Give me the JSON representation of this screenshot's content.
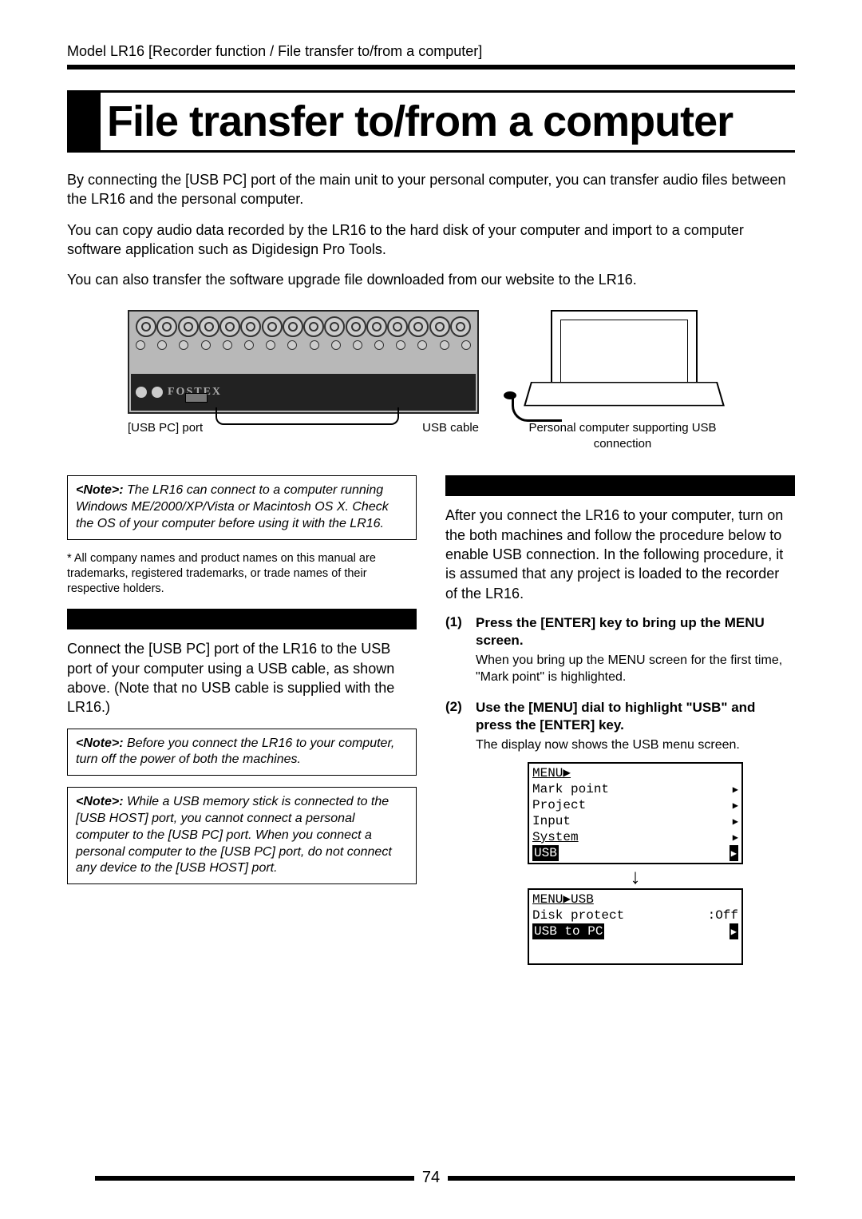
{
  "header": "Model LR16 [Recorder function / File transfer to/from a computer]",
  "title": "File transfer to/from a computer",
  "intro": {
    "p1": "By connecting the [USB PC] port of the main unit to your personal computer, you can transfer audio files between the LR16 and the personal computer.",
    "p2": "You can copy audio data recorded by the LR16 to the hard disk of your computer and import to a computer software application such as Digidesign Pro Tools.",
    "p3": "You can also transfer the software upgrade file downloaded from our website to the LR16."
  },
  "diagram": {
    "usb_port_label": "[USB PC] port",
    "usb_cable_label": "USB cable",
    "laptop_label": "Personal computer supporting USB connection",
    "brand": "FOSTEX"
  },
  "left": {
    "note1_label": "<Note>:",
    "note1": " The LR16 can connect to a computer running Windows ME/2000/XP/Vista or Macintosh OS X. Check the OS of your computer before using it with the LR16.",
    "footnote": "* All company names and product names on this manual are trademarks, registered trademarks, or trade names of their respective holders.",
    "body": "Connect the [USB PC] port of the LR16 to the USB port of your computer using a USB cable, as shown above. (Note that no USB cable is supplied with the LR16.)",
    "note2_label": "<Note>:",
    "note2": " Before you connect the LR16 to your computer, turn off the power of both the machines.",
    "note3_label": "<Note>:",
    "note3": " While a USB memory stick is connected to the [USB HOST] port, you cannot connect a personal computer to the [USB PC] port. When you connect a personal computer to the [USB PC] port, do not connect any device to the [USB HOST] port."
  },
  "right": {
    "body": "After you connect the LR16 to your computer, turn on the both machines and follow the procedure below to enable USB connection. In the following procedure, it is assumed that any project is loaded to the recorder of the LR16.",
    "step1_num": "(1)",
    "step1_title": "Press the [ENTER] key to bring up the MENU screen.",
    "step1_text": "When you bring up the MENU screen for the first time, \"Mark point\" is highlighted.",
    "step2_num": "(2)",
    "step2_title": "Use the [MENU] dial to highlight \"USB\" and press the [ENTER] key.",
    "step2_text": "The display now shows the USB menu screen.",
    "lcd1": {
      "title": "MENU▶",
      "items": [
        "Mark point",
        "Project",
        "Input",
        "System"
      ],
      "selected": "USB"
    },
    "lcd2": {
      "title": "MENU▶USB",
      "row1_l": "Disk protect",
      "row1_r": ":Off",
      "selected": "USB to PC"
    }
  },
  "page_number": "74"
}
